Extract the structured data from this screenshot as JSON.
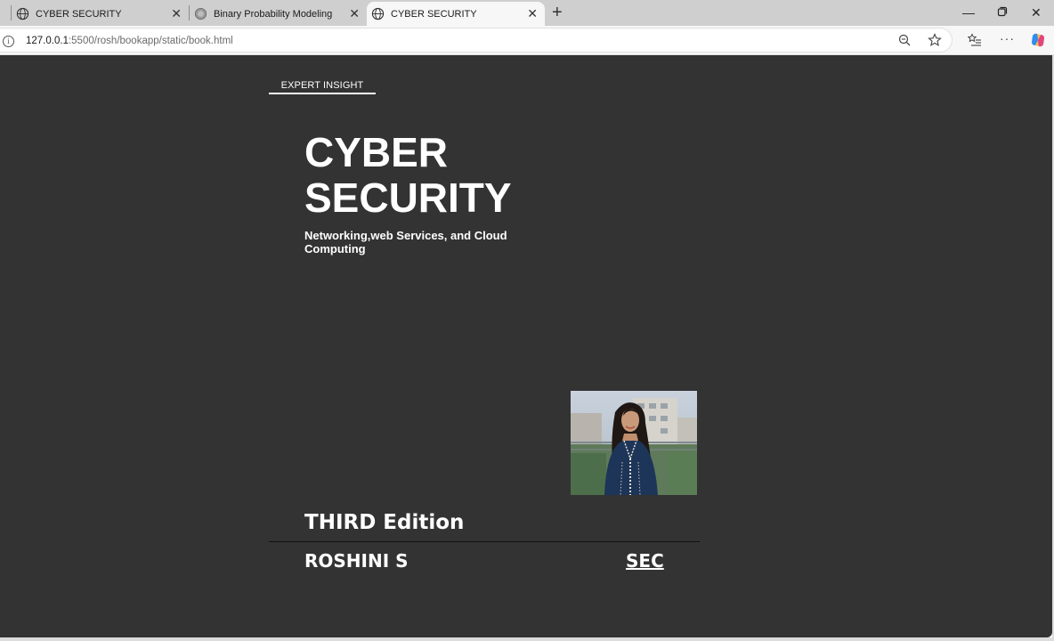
{
  "browser": {
    "tabs": [
      {
        "label": "CYBER SECURITY",
        "icon": "globe-icon"
      },
      {
        "label": "Binary Probability Modeling",
        "icon": "circle-icon"
      },
      {
        "label": "CYBER SECURITY",
        "icon": "globe-icon",
        "active": true
      }
    ],
    "url_host": "127.0.0.1",
    "url_path": ":5500/rosh/bookapp/static/book.html"
  },
  "book": {
    "badge": "EXPERT INSIGHT",
    "title_line1": "CYBER",
    "title_line2": "SECURITY",
    "subtitle": "Networking,web Services, and Cloud Computing",
    "edition": "THIRD Edition",
    "author": "ROSHINI S",
    "publisher": "SEC"
  },
  "colors": {
    "page_background": "#333333",
    "text": "#ffffff",
    "tabstrip": "#cfcfcf"
  }
}
